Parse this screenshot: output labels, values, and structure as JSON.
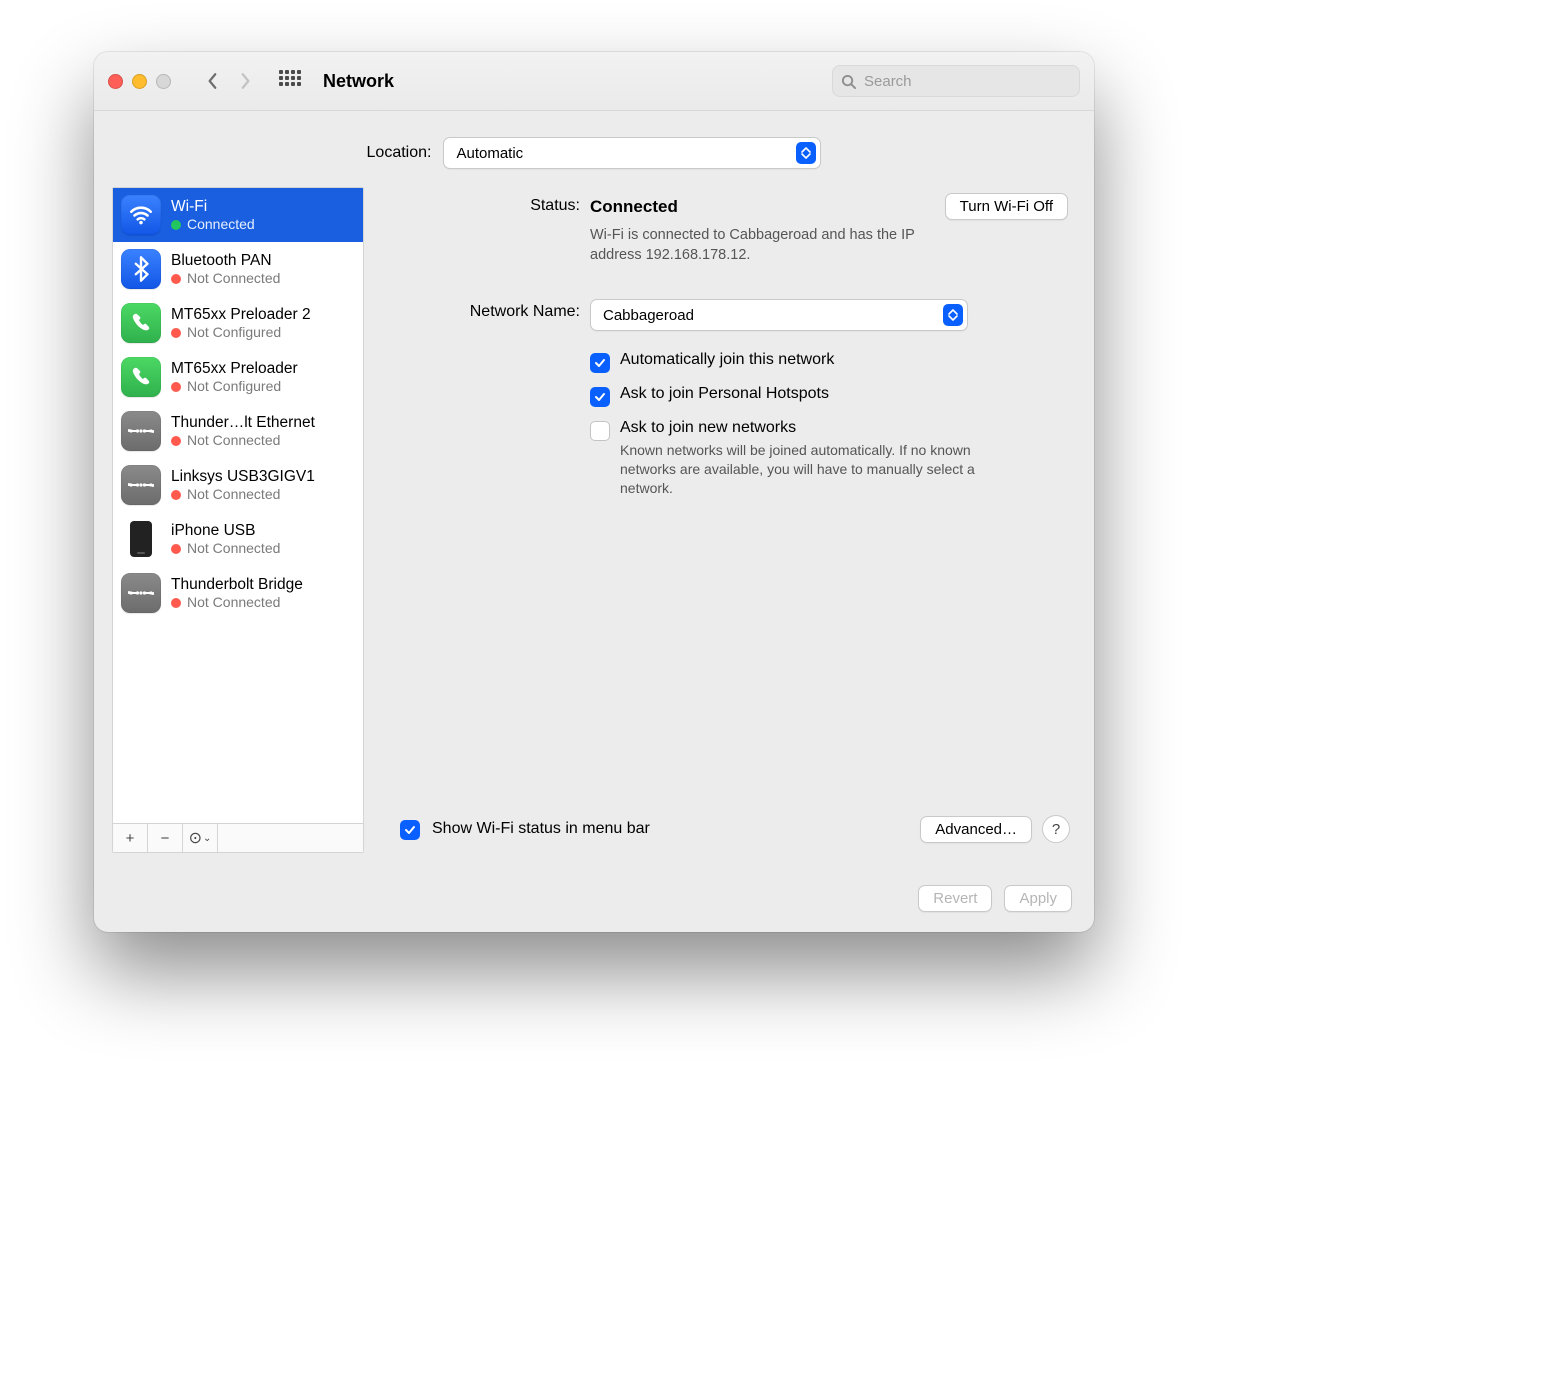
{
  "toolbar": {
    "title": "Network",
    "search_placeholder": "Search"
  },
  "location": {
    "label": "Location:",
    "value": "Automatic"
  },
  "sidebar": {
    "items": [
      {
        "name": "Wi-Fi",
        "status": "Connected",
        "dot": "green",
        "icon": "wifi",
        "selected": true
      },
      {
        "name": "Bluetooth PAN",
        "status": "Not Connected",
        "dot": "red",
        "icon": "bt"
      },
      {
        "name": "MT65xx Preloader 2",
        "status": "Not Configured",
        "dot": "red",
        "icon": "phone"
      },
      {
        "name": "MT65xx Preloader",
        "status": "Not Configured",
        "dot": "red",
        "icon": "phone"
      },
      {
        "name": "Thunder…lt Ethernet",
        "status": "Not Connected",
        "dot": "red",
        "icon": "eth"
      },
      {
        "name": "Linksys USB3GIGV1",
        "status": "Not Connected",
        "dot": "red",
        "icon": "eth"
      },
      {
        "name": "iPhone USB",
        "status": "Not Connected",
        "dot": "red",
        "icon": "iphone"
      },
      {
        "name": "Thunderbolt Bridge",
        "status": "Not Connected",
        "dot": "red",
        "icon": "eth"
      }
    ]
  },
  "detail": {
    "status_label": "Status:",
    "status_value": "Connected",
    "toggle_button": "Turn Wi-Fi Off",
    "status_desc": "Wi-Fi is connected to Cabbageroad and has the IP address 192.168.178.12.",
    "network_name_label": "Network Name:",
    "network_name_value": "Cabbageroad",
    "auto_join_label": "Automatically join this network",
    "auto_join_checked": true,
    "ask_hotspot_label": "Ask to join Personal Hotspots",
    "ask_hotspot_checked": true,
    "ask_new_label": "Ask to join new networks",
    "ask_new_checked": false,
    "ask_new_hint": "Known networks will be joined automatically. If no known networks are available, you will have to manually select a network.",
    "show_status_label": "Show Wi-Fi status in menu bar",
    "show_status_checked": true,
    "advanced_button": "Advanced…",
    "help_button": "?"
  },
  "footer": {
    "revert": "Revert",
    "apply": "Apply"
  }
}
